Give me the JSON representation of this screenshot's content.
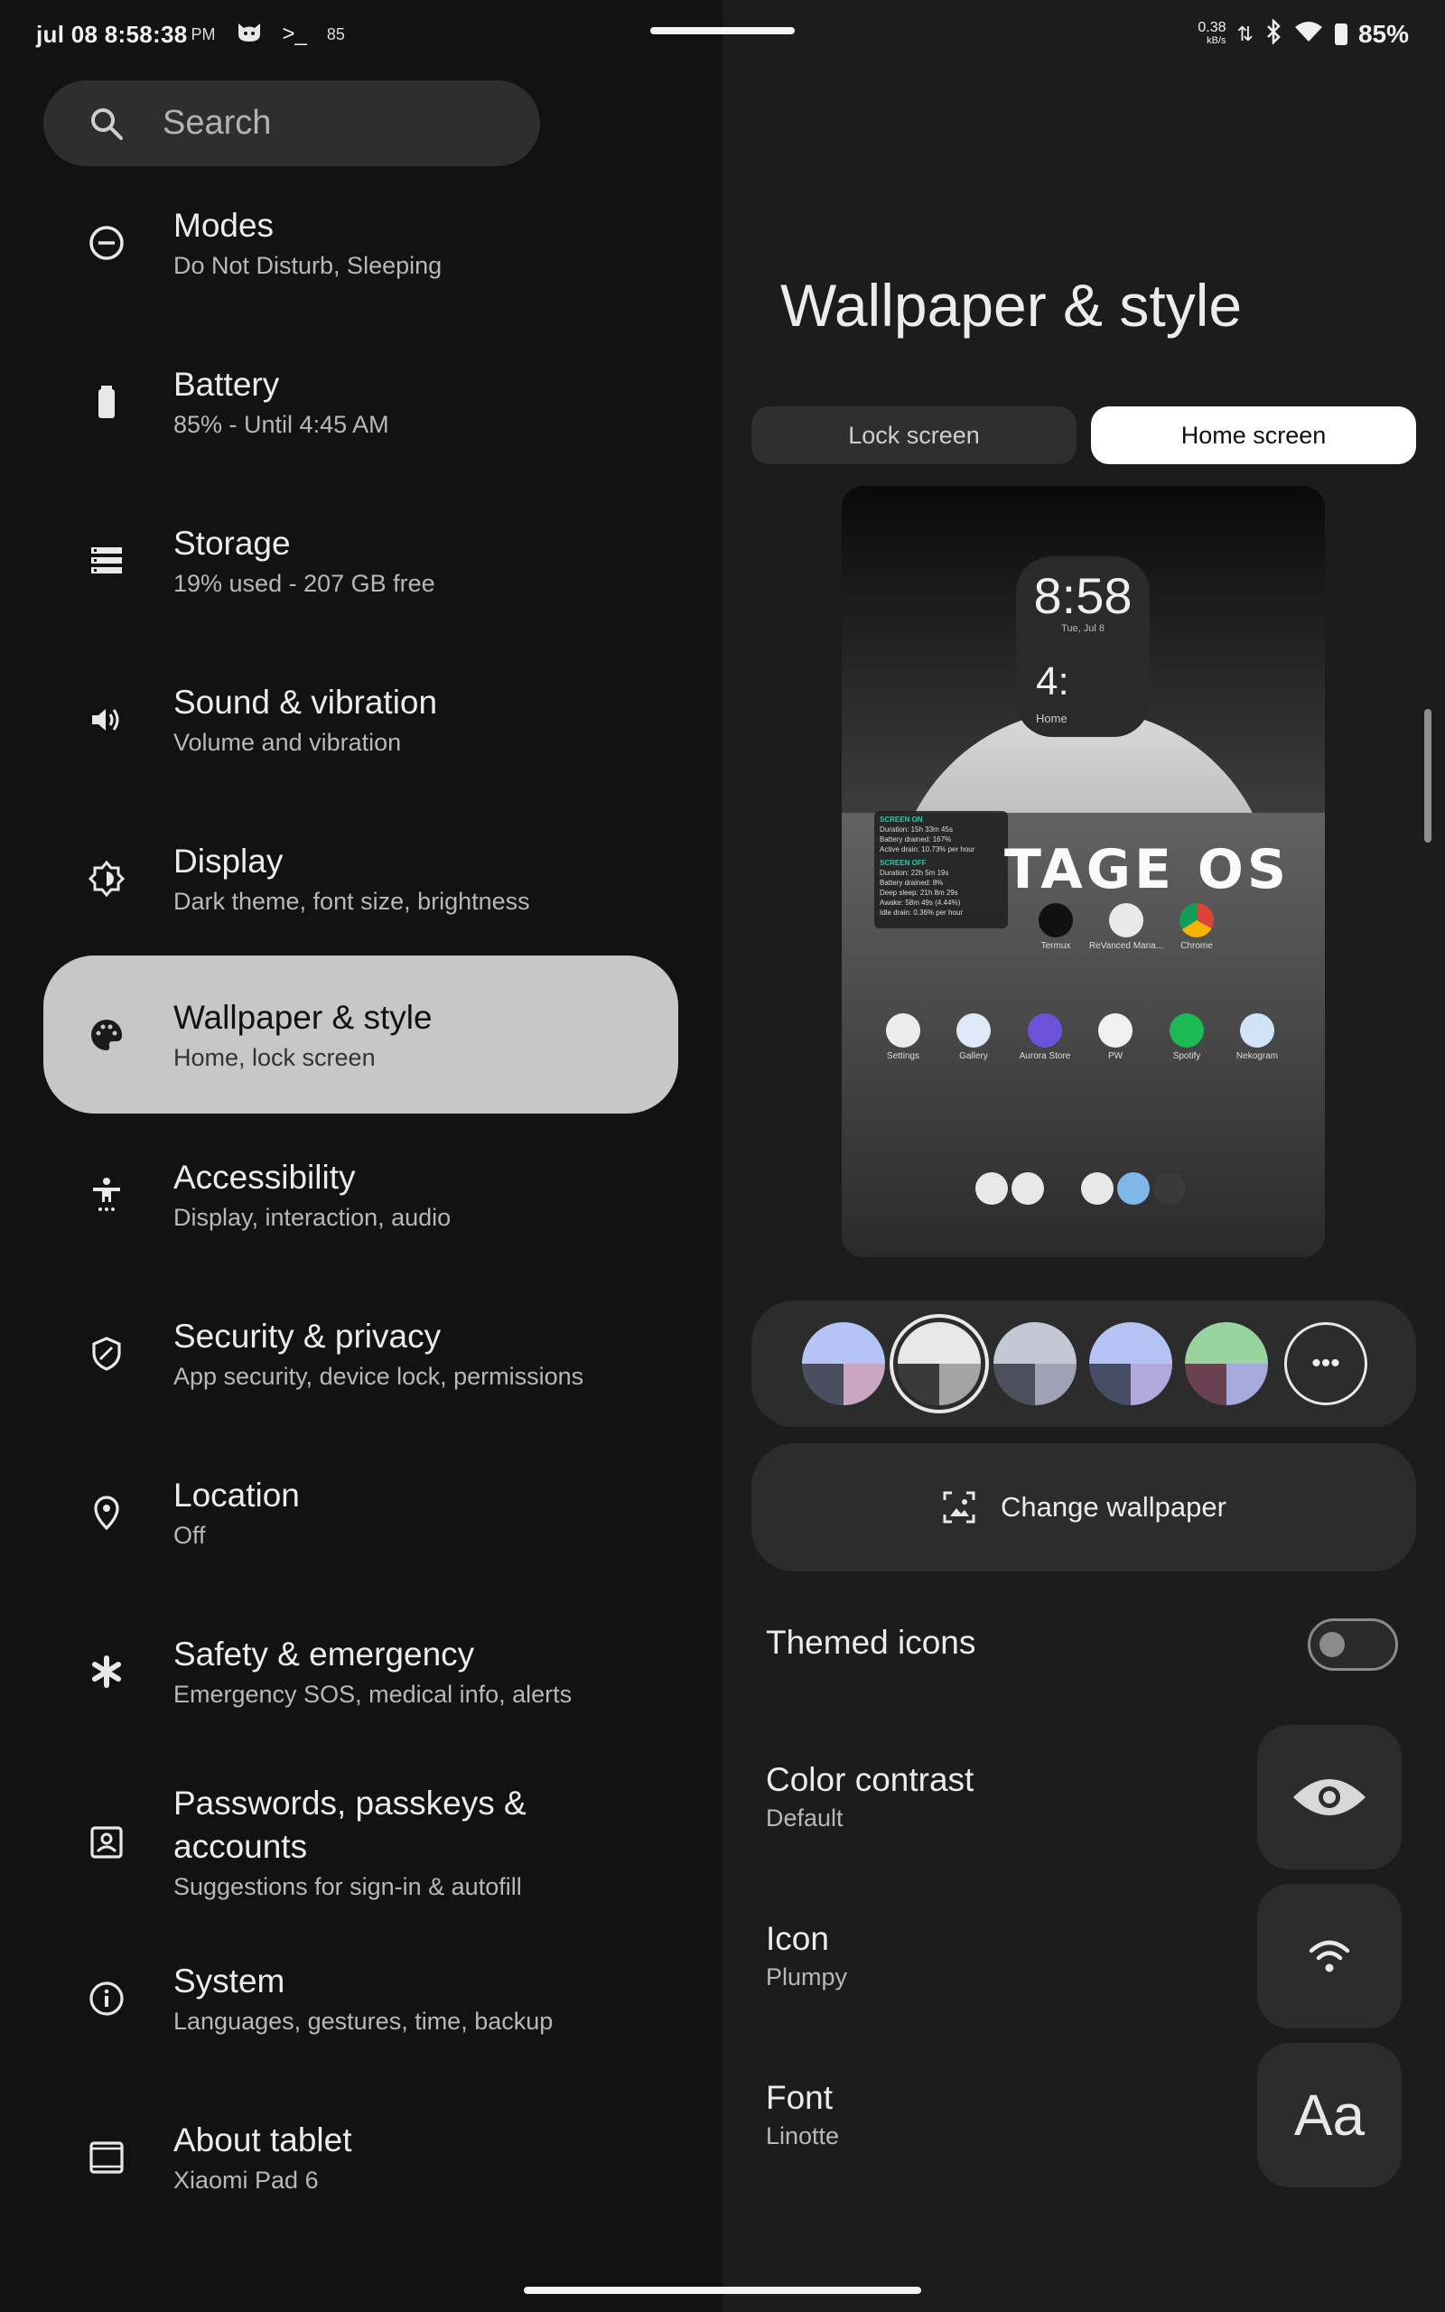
{
  "status_bar": {
    "time": "jul 08 8:58:38",
    "ampm": "PM",
    "terminal_glyph": ">_",
    "notif_count": "85",
    "net_speed": "0.38",
    "net_unit": "kB/s",
    "battery": "85%"
  },
  "search": {
    "placeholder": "Search"
  },
  "settings": [
    {
      "title": "Modes",
      "subtitle": "Do Not Disturb, Sleeping",
      "icon": "minus-circle-icon"
    },
    {
      "title": "Battery",
      "subtitle": "85% - Until 4:45 AM",
      "icon": "battery-icon"
    },
    {
      "title": "Storage",
      "subtitle": "19% used - 207 GB free",
      "icon": "storage-icon"
    },
    {
      "title": "Sound & vibration",
      "subtitle": "Volume and vibration",
      "icon": "speaker-icon"
    },
    {
      "title": "Display",
      "subtitle": "Dark theme, font size, brightness",
      "icon": "brightness-icon"
    },
    {
      "title": "Wallpaper & style",
      "subtitle": "Home, lock screen",
      "icon": "palette-icon",
      "selected": true
    },
    {
      "title": "Accessibility",
      "subtitle": "Display, interaction, audio",
      "icon": "accessibility-icon"
    },
    {
      "title": "Security & privacy",
      "subtitle": "App security, device lock, permissions",
      "icon": "shield-icon"
    },
    {
      "title": "Location",
      "subtitle": "Off",
      "icon": "location-pin-icon"
    },
    {
      "title": "Safety & emergency",
      "subtitle": "Emergency SOS, medical info, alerts",
      "icon": "asterisk-icon"
    },
    {
      "title": "Passwords, passkeys & accounts",
      "subtitle": "Suggestions for sign-in & autofill",
      "icon": "account-box-icon"
    },
    {
      "title": "System",
      "subtitle": "Languages, gestures, time, backup",
      "icon": "info-icon"
    },
    {
      "title": "About tablet",
      "subtitle": "Xiaomi Pad 6",
      "icon": "tablet-icon"
    }
  ],
  "wallpaper": {
    "page_title": "Wallpaper & style",
    "tabs": {
      "lock": "Lock screen",
      "home": "Home screen",
      "active": "home"
    },
    "preview": {
      "clock_time": "8:58",
      "clock_date": "Tue, Jul 8",
      "clock_hour_partial": "4:",
      "clock_label": "Home",
      "screen_on_header": "SCREEN ON",
      "screen_on_lines": [
        "Duration: 15h 33m 45s",
        "Battery drained: 167%",
        "Active drain: 10.73% per hour"
      ],
      "screen_off_header": "SCREEN OFF",
      "screen_off_lines": [
        "Duration: 22h 5m 19s",
        "Battery drained: 8%",
        "Deep sleep: 21h 8m 29s",
        "Awake: 58m 49s (4.44%)",
        "Idle drain: 0.36% per hour"
      ],
      "brand_text": "TAGE OS",
      "apps_row1": [
        "Termux",
        "ReVanced Mana...",
        "Chrome"
      ],
      "apps_row2": [
        "Settings",
        "Gallery",
        "Aurora Store",
        "PW",
        "Spotify",
        "Nekogram"
      ]
    },
    "color_options": [
      [
        "#b4c4f4",
        "#4a4f60",
        "#c9a6c2"
      ],
      [
        "#e8e8e8",
        "#3a3a3a",
        "#a4a4a4"
      ],
      [
        "#c4c7d4",
        "#4d505c",
        "#9ea2b2"
      ],
      [
        "#b4c2f4",
        "#484d66",
        "#b1a8dc"
      ],
      [
        "#98d4a0",
        "#6a4150",
        "#a6a9dc"
      ]
    ],
    "more_options": "•••",
    "change_wallpaper": "Change wallpaper",
    "themed_icons": {
      "label": "Themed icons",
      "enabled": false
    },
    "color_contrast": {
      "label": "Color contrast",
      "value": "Default"
    },
    "icon": {
      "label": "Icon",
      "value": "Plumpy"
    },
    "font": {
      "label": "Font",
      "value": "Linotte",
      "preview": "Aa"
    }
  }
}
